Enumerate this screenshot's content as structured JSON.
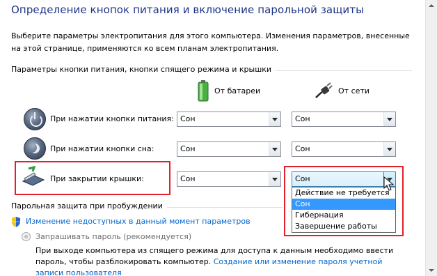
{
  "header": {
    "title": "Определение кнопок питания и включение парольной защиты",
    "description": "Выберите параметры электропитания для этого компьютера. Изменения параметров, внесенные на этой странице, применяются ко всем планам электропитания."
  },
  "buttons_section": {
    "label": "Параметры кнопки питания, кнопки спящего режима и крышки",
    "col_battery": "От батареи",
    "col_ac": "От сети",
    "rows": [
      {
        "label": "При нажатии кнопки питания:",
        "battery": "Сон",
        "ac": "Сон"
      },
      {
        "label": "При нажатии кнопки сна:",
        "battery": "Сон",
        "ac": "Сон"
      },
      {
        "label": "При закрытии крышки:",
        "battery": "Сон",
        "ac": "Сон"
      }
    ]
  },
  "dropdown": {
    "options": [
      "Действие не требуется",
      "Сон",
      "Гибернация",
      "Завершение работы"
    ],
    "selected": "Сон"
  },
  "password_section": {
    "label": "Парольная защита при пробуждении",
    "change_link": "Изменение недоступных в данный момент параметров",
    "radio_label": "Запрашивать пароль (рекомендуется)",
    "radio_desc": "При выходе компьютера из спящего режима для доступа к данным необходимо ввести пароль, чтобы разблокировать компьютер.",
    "create_link_part1": "Создание или изменение пароля учетной записи",
    "create_link_part2": "пользователя"
  },
  "colors": {
    "title": "#1e3287",
    "link": "#0066cc",
    "highlight": "#e0202a",
    "selection": "#3399ff"
  },
  "icons": [
    "battery-icon",
    "ac-plug-icon",
    "power-button-icon",
    "sleep-button-icon",
    "laptop-lid-icon",
    "shield-icon",
    "scroll-up-icon",
    "scroll-down-icon",
    "mouse-cursor-icon"
  ]
}
